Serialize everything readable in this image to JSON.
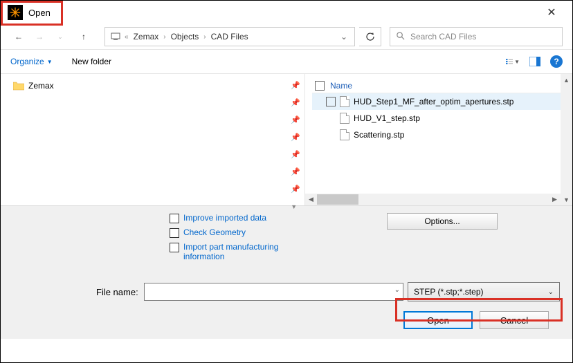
{
  "title": "Open",
  "breadcrumb": [
    "Zemax",
    "Objects",
    "CAD Files"
  ],
  "search": {
    "placeholder": "Search CAD Files"
  },
  "toolbar": {
    "organize": "Organize",
    "newfolder": "New folder"
  },
  "sidebar": {
    "items": [
      {
        "label": "Zemax"
      }
    ]
  },
  "filelist": {
    "name_header": "Name",
    "rows": [
      {
        "label": "HUD_Step1_MF_after_optim_apertures.stp",
        "selected": true,
        "show_check": true
      },
      {
        "label": "HUD_V1_step.stp",
        "selected": false,
        "show_check": false
      },
      {
        "label": "Scattering.stp",
        "selected": false,
        "show_check": false
      }
    ]
  },
  "options": {
    "improve": "Improve imported data",
    "geometry": "Check Geometry",
    "import_mfg": "Import part manufacturing information",
    "options_btn": "Options..."
  },
  "footer": {
    "filename_label": "File name:",
    "filename_value": "",
    "filetype": "STEP (*.stp;*.step)",
    "open": "Open",
    "cancel": "Cancel"
  }
}
